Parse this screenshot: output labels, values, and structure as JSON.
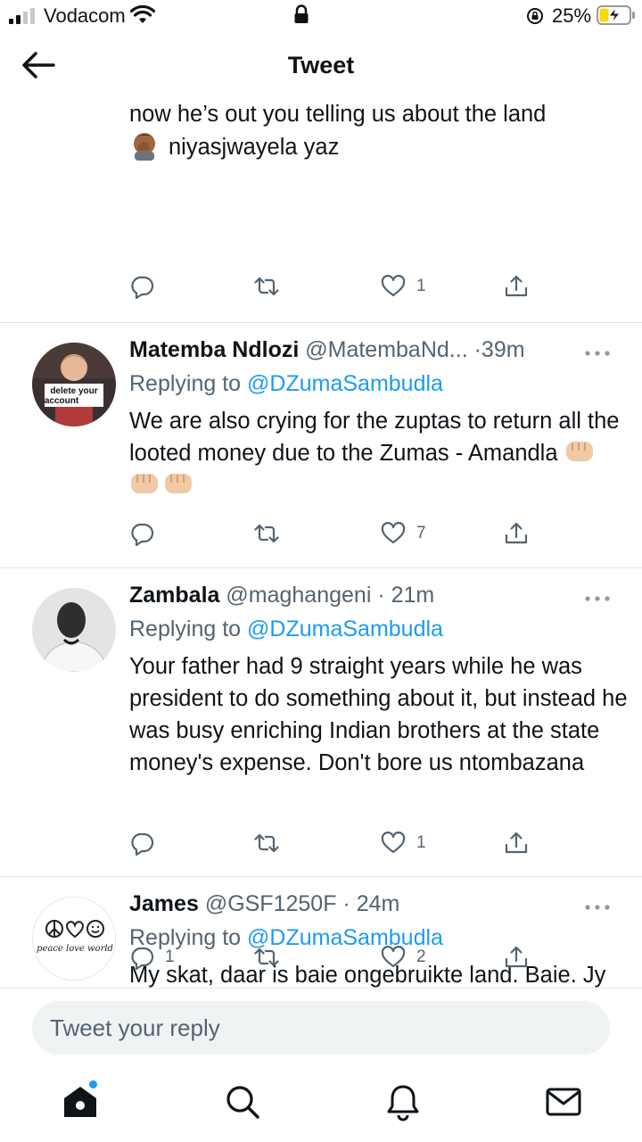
{
  "status_bar": {
    "carrier": "Vodacom",
    "battery_percent": "25%",
    "signal_bars_active": 2,
    "signal_bars_total": 4
  },
  "header": {
    "title": "Tweet"
  },
  "tweets": [
    {
      "text_line1": "now he’s out you telling us about the land",
      "text_line2": "niyasjwayela yaz",
      "reply_count": "",
      "retweet_count": "",
      "like_count": "1"
    },
    {
      "name": "Matemba Ndlozi",
      "handle": "@MatembaNd...",
      "time": "39m",
      "replying_to_label": "Replying to",
      "replying_to": "@DZumaSambudla",
      "text": "We are also crying for the zuptas to return all the looted money due to the Zumas - Amandla",
      "avatar_sign": "delete your account",
      "reply_count": "",
      "retweet_count": "",
      "like_count": "7"
    },
    {
      "name": "Zambala",
      "handle": "@maghangeni",
      "time": "21m",
      "replying_to_label": "Replying to",
      "replying_to": "@DZumaSambudla",
      "text": "Your father had 9 straight years while he was president to do something about it, but instead he was busy enriching Indian brothers at the state money's expense. Don't bore us ntombazana",
      "reply_count": "",
      "retweet_count": "",
      "like_count": "1"
    },
    {
      "name": "James",
      "handle": "@GSF1250F",
      "time": "24m",
      "replying_to_label": "Replying to",
      "replying_to": "@DZumaSambudla",
      "text": "My skat, daar is baie ongebruikte land. Baie. Jy kan kies en keur. Maklik nê.",
      "avatar_text": "peace love world",
      "reply_count": "1",
      "retweet_count": "",
      "like_count": "2"
    }
  ],
  "reply_box": {
    "placeholder": "Tweet your reply"
  },
  "colors": {
    "accent": "#1d9bf0",
    "text_primary": "#0f1419",
    "text_secondary": "#536471",
    "divider": "#e4e8eb",
    "battery_charging": "#f5d90a"
  },
  "icons": [
    "back-arrow-icon",
    "more-icon",
    "reply-icon",
    "retweet-icon",
    "like-icon",
    "share-icon",
    "home-icon",
    "search-icon",
    "notifications-icon",
    "messages-icon"
  ]
}
